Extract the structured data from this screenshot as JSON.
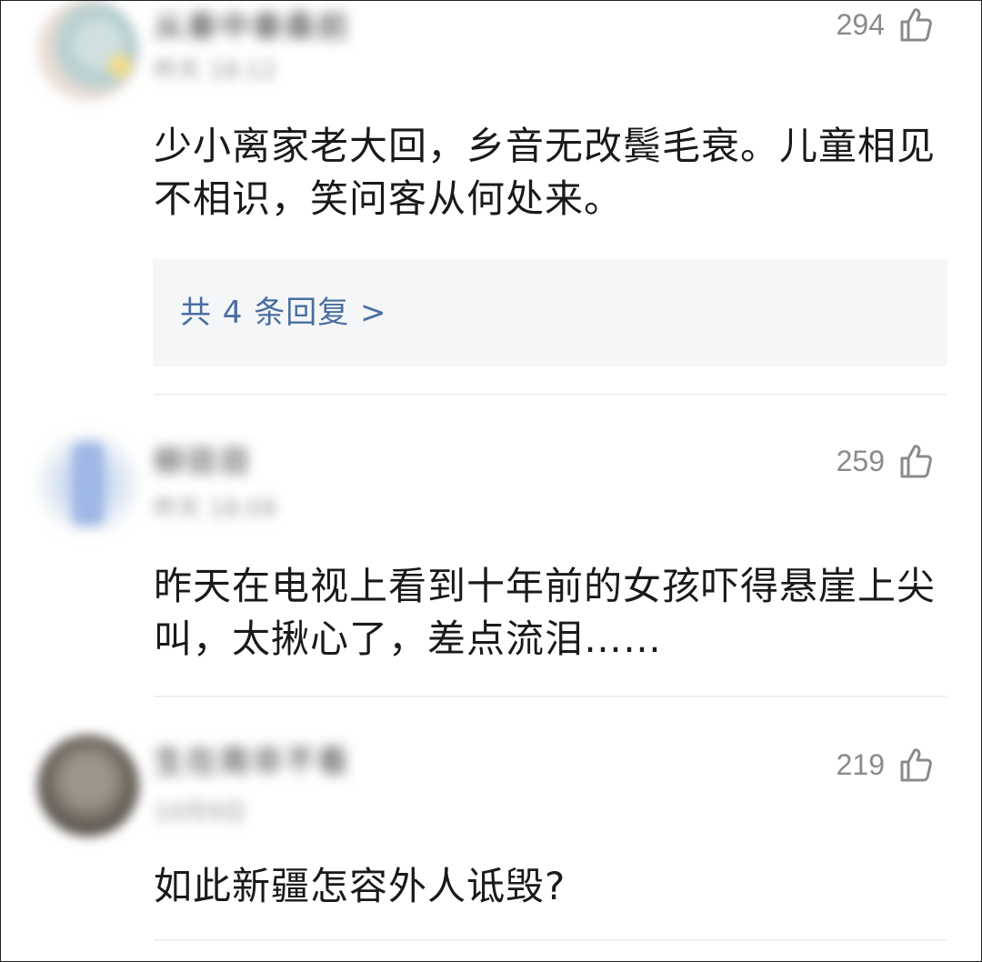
{
  "comments": [
    {
      "username": "从秦中秦桑前",
      "meta": "昨天 18:12",
      "likes": "294",
      "text": "少小离家老大回，乡音无改鬓毛衰。儿童相见不相识，笑问客从何处来。",
      "replies_label": "共 4 条回复 >"
    },
    {
      "username": "柳目目",
      "meta": "昨天 18:09",
      "likes": "259",
      "text": "昨天在电视上看到十年前的女孩吓得悬崖上尖叫，太揪心了，差点流泪……"
    },
    {
      "username": "生在南非不看",
      "meta": "10月9日",
      "likes": "219",
      "text": "如此新疆怎容外人诋毁?"
    }
  ],
  "icons": {
    "like": "thumbs-up-outline-icon"
  },
  "colors": {
    "like_count": "#8b8b8b",
    "reply_link": "#4a6ea0",
    "reply_bg": "#f5f6f8",
    "text": "#1a1a1a"
  }
}
